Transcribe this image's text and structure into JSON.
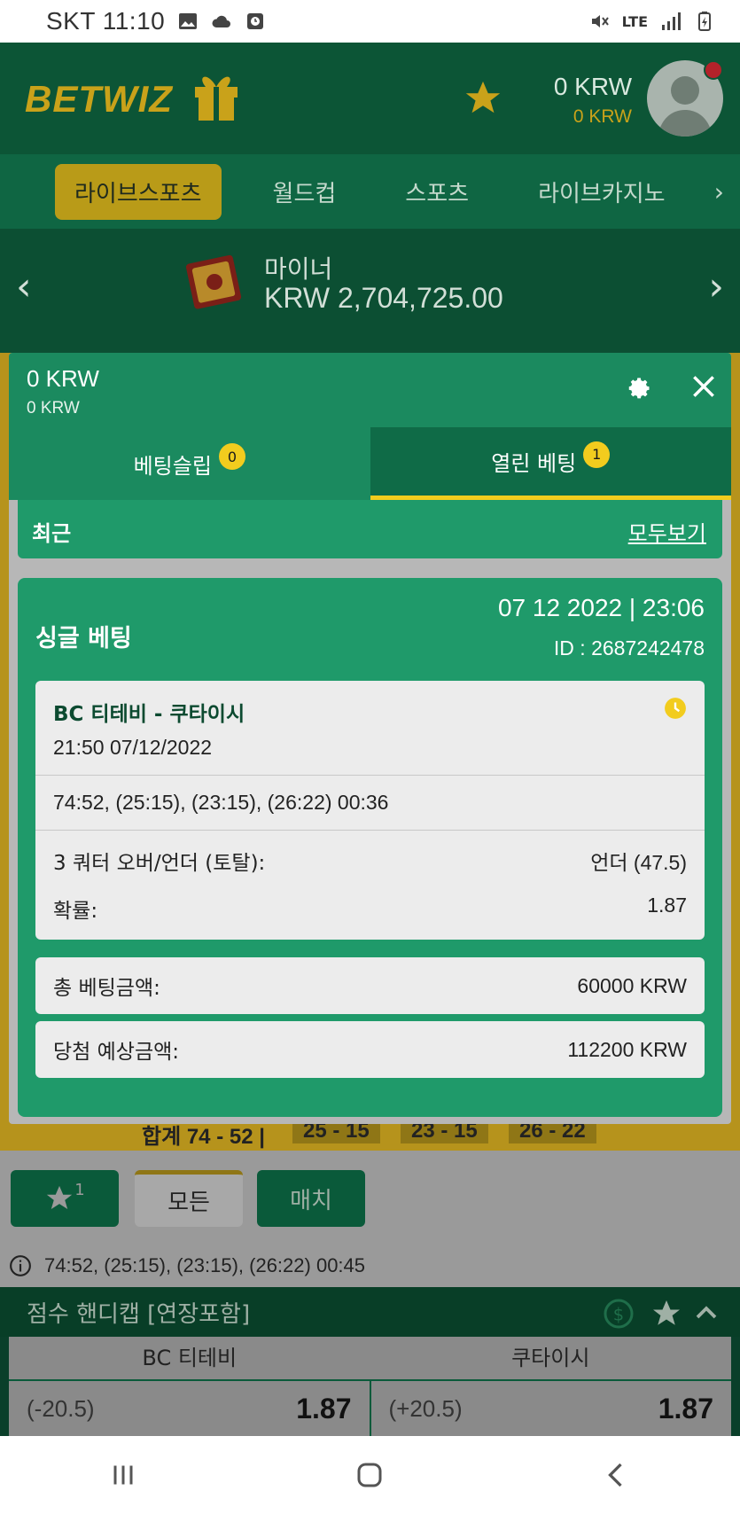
{
  "status_bar": {
    "carrier_time": "SKT 11:10",
    "network": "LTE"
  },
  "header": {
    "logo_text": "BETWIZ",
    "balance": "0 KRW",
    "bonus_balance": "0 KRW"
  },
  "nav_tabs": [
    {
      "label": "라이브스포츠",
      "active": true
    },
    {
      "label": "월드컵",
      "active": false
    },
    {
      "label": "스포츠",
      "active": false
    },
    {
      "label": "라이브카지노",
      "active": false
    }
  ],
  "jackpot": {
    "title": "마이너",
    "amount": "KRW 2,704,725.00"
  },
  "background": {
    "score_total": "합계  74 - 52  |",
    "score_q": [
      "25 - 15",
      "23 - 15",
      "26 - 22"
    ],
    "filters": {
      "fav_count": "1",
      "all_label": "모든",
      "match_label": "매치"
    },
    "info_text": "74:52, (25:15), (23:15), (26:22) 00:45",
    "market_title": "점수 핸디캡 [연장포함]",
    "team_home": "BC 티테비",
    "team_away": "쿠타이시",
    "home_line": "(-20.5)",
    "home_odd": "1.87",
    "away_line": "(+20.5)",
    "away_odd": "1.87"
  },
  "modal": {
    "balance": "0 KRW",
    "bonus_balance": "0 KRW",
    "tabs": [
      {
        "label": "베팅슬립",
        "count": "0"
      },
      {
        "label": "열린 베팅",
        "count": "1"
      }
    ],
    "recent_label": "최근",
    "view_all_label": "모두보기",
    "bet": {
      "type": "싱글 베팅",
      "datetime": "07 12 2022 | 23:06",
      "id_text": "ID :  2687242478",
      "match": "BC 티테비 - 쿠타이시",
      "match_time": "21:50   07/12/2022",
      "score": "74:52, (25:15), (23:15), (26:22) 00:36",
      "market_label": "3 쿼터 오버/언더 (토탈):",
      "selection": "언더 (47.5)",
      "odds_label": "확률:",
      "odds": "1.87",
      "stake_label": "총 베팅금액:",
      "stake": "60000 KRW",
      "payout_label": "당첨 예상금액:",
      "payout": "112200 KRW"
    }
  },
  "colors": {
    "brand_green": "#0c5536",
    "accent_yellow": "#f2cc1e",
    "card_green": "#1f9a6a"
  }
}
